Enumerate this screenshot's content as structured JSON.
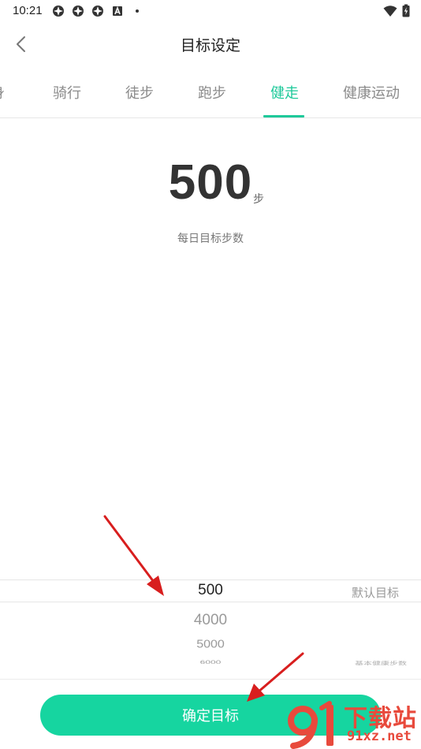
{
  "status_bar": {
    "time": "10:21"
  },
  "header": {
    "title": "目标设定"
  },
  "tabs": [
    {
      "label": "身",
      "active": false
    },
    {
      "label": "骑行",
      "active": false
    },
    {
      "label": "徒步",
      "active": false
    },
    {
      "label": "跑步",
      "active": false
    },
    {
      "label": "健走",
      "active": true
    },
    {
      "label": "健康运动",
      "active": false
    }
  ],
  "goal": {
    "value": "500",
    "unit": "步",
    "caption": "每日目标步数"
  },
  "picker": {
    "selected": "500",
    "selected_note": "默认目标",
    "options": [
      "4000",
      "5000",
      "6000"
    ],
    "option_note": "基本健康步数"
  },
  "confirm_button": {
    "label": "确定目标"
  },
  "watermark": {
    "main": "下载站",
    "url": "91xz.net"
  },
  "colors": {
    "accent": "#1ec99a",
    "button": "#16d5a0",
    "arrow": "#d81e1e",
    "watermark": "#e84a3c"
  }
}
